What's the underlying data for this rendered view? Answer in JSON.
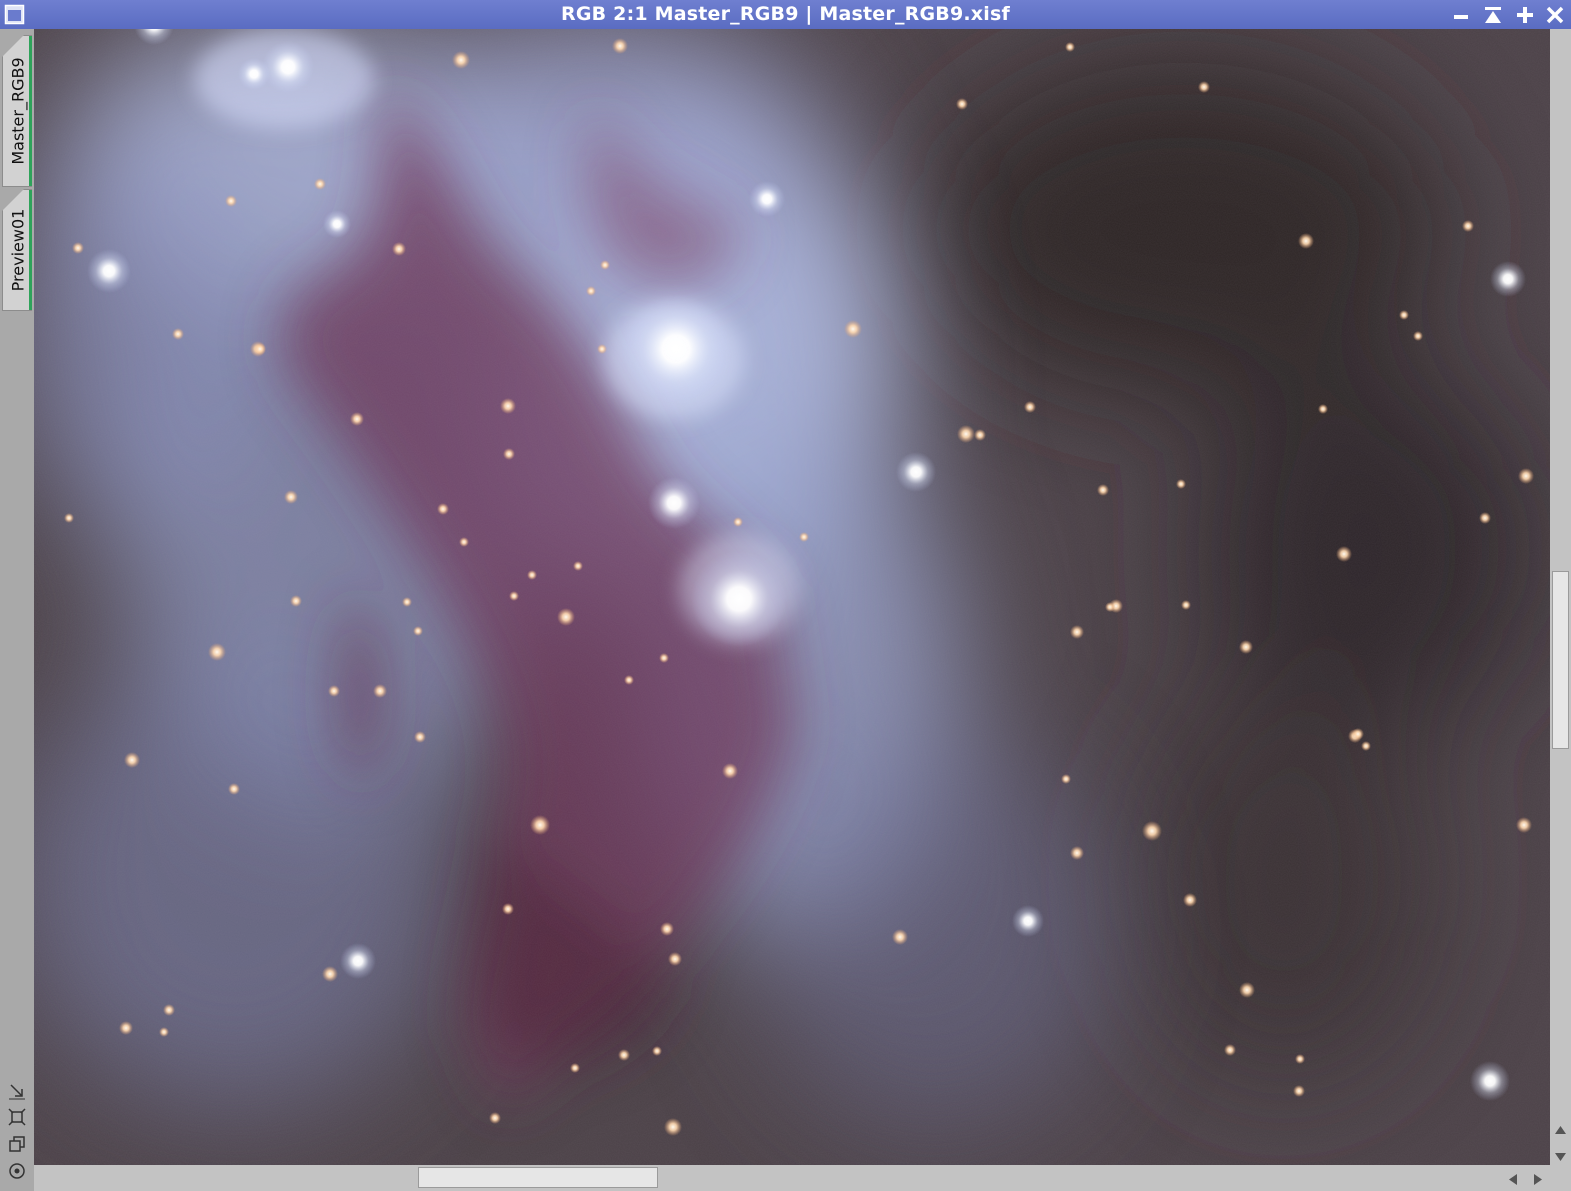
{
  "window": {
    "title": "RGB 2:1 Master_RGB9 | Master_RGB9.xisf",
    "titlebar_color": "#5f70c6",
    "controls": [
      "minimize-icon",
      "shade-icon",
      "maximize-icon",
      "close-icon"
    ]
  },
  "side_tabs": [
    {
      "label": "Master_RGB9"
    },
    {
      "label": "Preview01"
    }
  ],
  "side_tools": [
    "zoom-to-fit-icon",
    "fit-view-icon",
    "clone-view-icon",
    "target-icon"
  ],
  "image": {
    "description_icon": "nebula-image",
    "background_color": "#4a4046",
    "nebula_color": "#8c96c8",
    "dust_color": "#7a3c60"
  },
  "scrollbars": {
    "vertical": {
      "position": 0.48,
      "visible_fraction": 0.16
    },
    "horizontal": {
      "position": 0.25,
      "visible_fraction": 0.16
    }
  }
}
